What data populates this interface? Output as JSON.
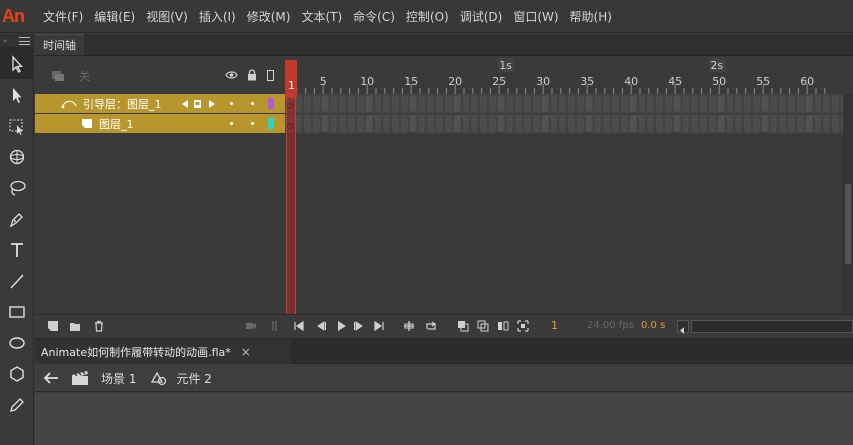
{
  "app": {
    "logo": "An"
  },
  "menu": [
    "文件(F)",
    "编辑(E)",
    "视图(V)",
    "插入(I)",
    "修改(M)",
    "文本(T)",
    "命令(C)",
    "控制(O)",
    "调试(D)",
    "窗口(W)",
    "帮助(H)"
  ],
  "tools": [
    "selection-tool",
    "subselection-tool",
    "free-transform-tool",
    "3d-rotation-tool",
    "lasso-tool",
    "pen-tool",
    "text-tool",
    "line-tool",
    "rectangle-tool",
    "oval-tool",
    "polystar-tool",
    "pencil-tool"
  ],
  "timeline": {
    "tab_label": "时间轴",
    "header_hint": "关",
    "ruler_ticks": [
      "1",
      "5",
      "10",
      "15",
      "20",
      "25",
      "30",
      "35",
      "40",
      "45",
      "50",
      "55",
      "60"
    ],
    "ruler_seconds": [
      "1s",
      "2s"
    ],
    "layers": [
      {
        "name": "引导层：图层_1",
        "color": "#b05cd6",
        "type": "guide"
      },
      {
        "name": "图层_1",
        "color": "#27d6c4",
        "type": "normal"
      }
    ],
    "footer": {
      "current_frame": "1",
      "fps": "24.00 fps",
      "elapsed": "0.0 s"
    }
  },
  "document": {
    "tab_title": "Animate如何制作履带转动的动画.fla*",
    "close": "×"
  },
  "scene": {
    "scene_label": "场景 1",
    "symbol_label": "元件 2"
  },
  "colors": {
    "layer_selected": "#b8962e",
    "playhead": "#d23b3b",
    "logo": "#e8431c"
  }
}
